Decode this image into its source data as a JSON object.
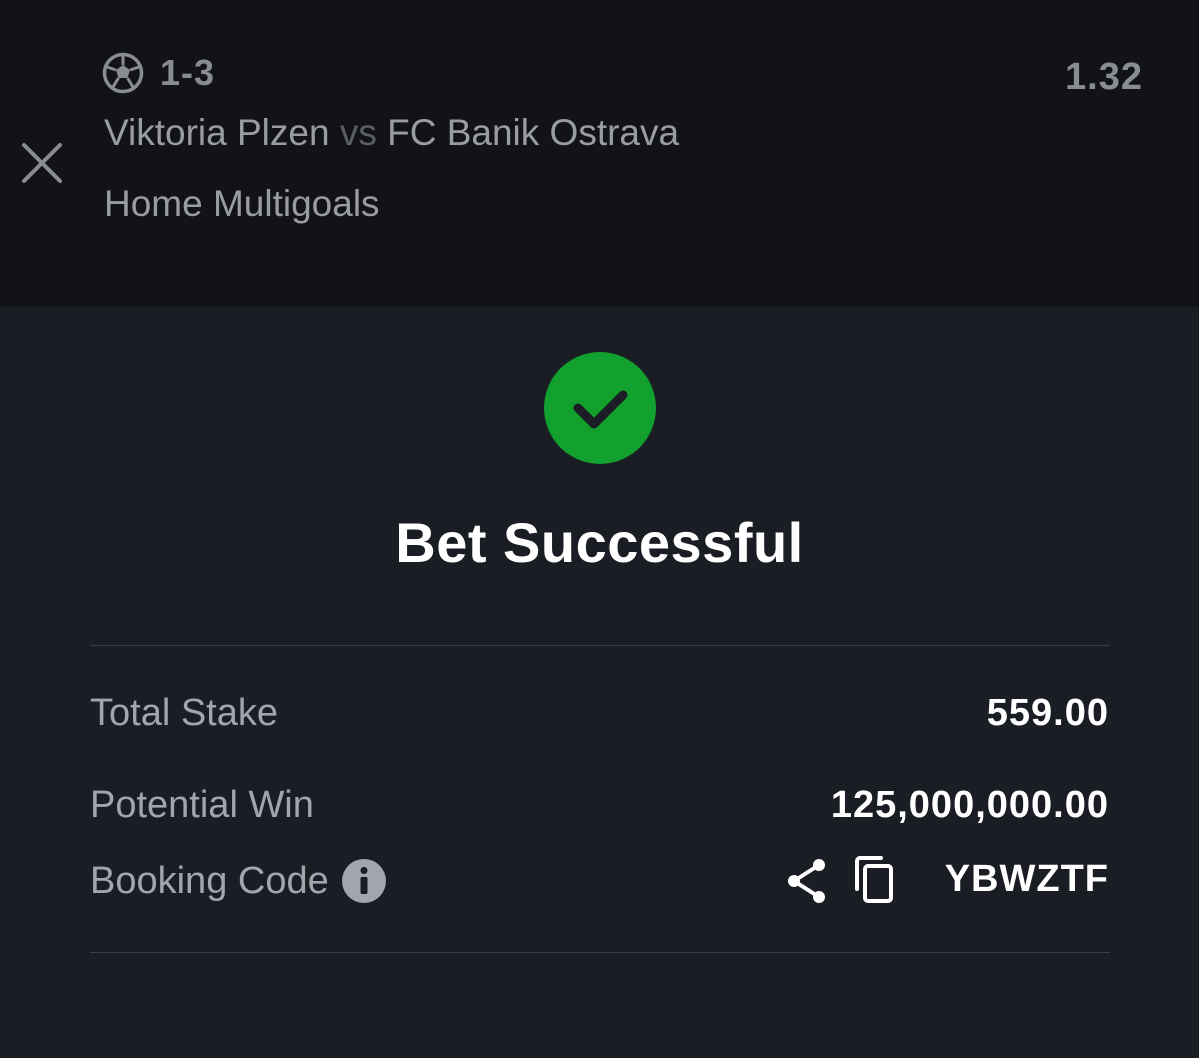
{
  "selection": {
    "sport_icon": "soccer-ball-icon",
    "score": "1-3",
    "odds": "1.32",
    "home_team": "Viktoria Plzen",
    "vs": "vs",
    "away_team": "FC Banik Ostrava",
    "market": "Home Multigoals",
    "close_icon": "close-icon"
  },
  "confirmation": {
    "status_icon": "check-circle-icon",
    "title": "Bet Successful",
    "accent_color": "#12a12e"
  },
  "summary": {
    "total_stake_label": "Total Stake",
    "total_stake_value": "559.00",
    "potential_win_label": "Potential Win",
    "potential_win_value": "125,000,000.00",
    "booking_code_label": "Booking Code",
    "booking_code_value": "YBWZTF",
    "info_icon": "info-icon",
    "share_icon": "share-icon",
    "copy_icon": "copy-icon"
  }
}
